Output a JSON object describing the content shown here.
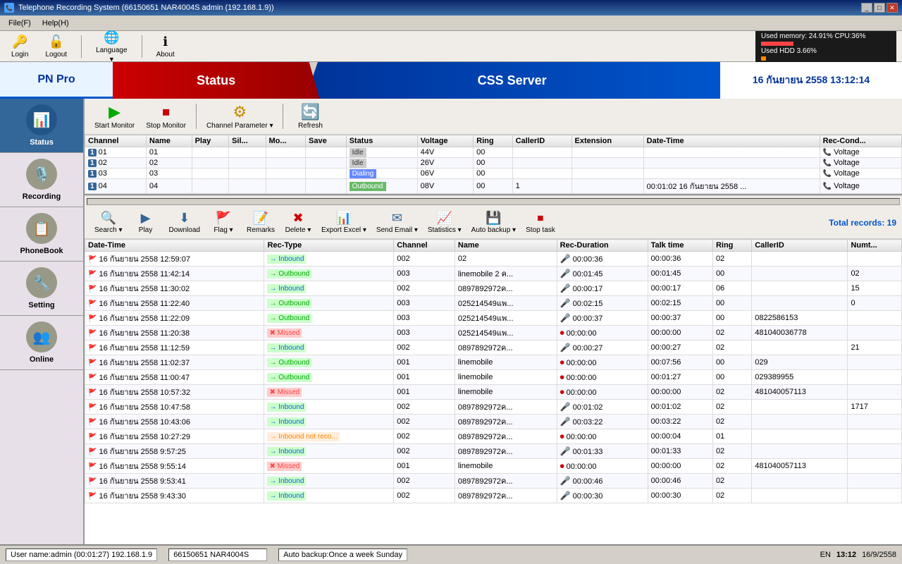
{
  "window": {
    "title": "Telephone Recording System (66150651 NAR4004S admin (192.168.1.9))"
  },
  "menubar": {
    "file_label": "File(F)",
    "help_label": "Help(H)"
  },
  "topbar": {
    "login_label": "Login",
    "logout_label": "Logout",
    "language_label": "Language",
    "about_label": "About"
  },
  "memory": {
    "cpu_label": "Used memory: 24.91% CPU:36%",
    "hdd_label": "Used HDD 3.66%",
    "cpu_pct": 25,
    "hdd_pct": 4
  },
  "banner": {
    "pn_pro": "PN Pro",
    "status": "Status",
    "css_server": "CSS Server",
    "datetime": "16 กันยายน 2558 13:12:14"
  },
  "sidebar": {
    "items": [
      {
        "label": "Status",
        "icon": "📊",
        "active": true
      },
      {
        "label": "Recording",
        "icon": "🎙️",
        "active": false
      },
      {
        "label": "PhoneBook",
        "icon": "📋",
        "active": false
      },
      {
        "label": "Setting",
        "icon": "🔧",
        "active": false
      },
      {
        "label": "Online",
        "icon": "👥",
        "active": false
      }
    ]
  },
  "monitor": {
    "buttons": [
      {
        "label": "Start Monitor",
        "icon": "▶"
      },
      {
        "label": "Stop Monitor",
        "icon": "⏹"
      },
      {
        "label": "Channel Parameter",
        "icon": "⚙",
        "dropdown": true
      },
      {
        "label": "Refresh",
        "icon": "🔄"
      }
    ],
    "columns": [
      "Channel",
      "Name",
      "Play",
      "Sil...",
      "Mo...",
      "Save",
      "Status",
      "Voltage",
      "Ring",
      "CallerID",
      "Extension",
      "Date-Time",
      "Rec-Cond..."
    ],
    "rows": [
      {
        "ch": "01",
        "name": "01",
        "play": "",
        "sil": "",
        "mo": "",
        "save": "",
        "status": "Idle",
        "voltage": "44V",
        "ring": "00",
        "callerid": "",
        "extension": "",
        "datetime": "",
        "reccond": "Voltage"
      },
      {
        "ch": "02",
        "name": "02",
        "play": "",
        "sil": "",
        "mo": "",
        "save": "",
        "status": "Idle",
        "voltage": "26V",
        "ring": "00",
        "callerid": "",
        "extension": "",
        "datetime": "",
        "reccond": "Voltage"
      },
      {
        "ch": "03",
        "name": "03",
        "play": "",
        "sil": "",
        "mo": "",
        "save": "",
        "status": "Dialing",
        "voltage": "06V",
        "ring": "00",
        "callerid": "",
        "extension": "",
        "datetime": "",
        "reccond": "Voltage"
      },
      {
        "ch": "04",
        "name": "04",
        "play": "",
        "sil": "",
        "mo": "",
        "save": "",
        "status": "Outbound",
        "voltage": "08V",
        "ring": "00",
        "callerid": "1",
        "extension": "",
        "datetime": "00:01:02 16 กันยายน 2558 ...",
        "reccond": "Voltage"
      }
    ]
  },
  "recording": {
    "total_records": "Total records: 19",
    "buttons": [
      {
        "label": "Search",
        "icon": "🔍",
        "dropdown": true
      },
      {
        "label": "Play",
        "icon": "▶"
      },
      {
        "label": "Download",
        "icon": "⬇",
        "dropdown": false
      },
      {
        "label": "Flag",
        "icon": "🚩",
        "dropdown": true
      },
      {
        "label": "Remarks",
        "icon": "📝"
      },
      {
        "label": "Delete",
        "icon": "✖",
        "dropdown": true
      },
      {
        "label": "Export Excel",
        "icon": "📊",
        "dropdown": true
      },
      {
        "label": "Send Email",
        "icon": "✉",
        "dropdown": true
      },
      {
        "label": "Statistics",
        "icon": "📈",
        "dropdown": true
      },
      {
        "label": "Auto backup",
        "icon": "💾",
        "dropdown": true
      },
      {
        "label": "Stop task",
        "icon": "⏹"
      }
    ],
    "columns": [
      "Date-Time",
      "Rec-Type",
      "Channel",
      "Name",
      "Rec-Duration",
      "Talk time",
      "Ring",
      "CallerID",
      "Numt..."
    ],
    "rows": [
      {
        "datetime": "16 กันยายน 2558 12:59:07",
        "type": "Inbound",
        "channel": "002",
        "name": "02",
        "duration": "00:00:36",
        "talk": "00:00:36",
        "ring": "02",
        "callerid": "",
        "num": ""
      },
      {
        "datetime": "16 กันยายน 2558 11:42:14",
        "type": "Outbound",
        "channel": "003",
        "name": "linemobile 2 ค...",
        "duration": "00:01:45",
        "talk": "00:01:45",
        "ring": "00",
        "callerid": "",
        "num": "02"
      },
      {
        "datetime": "16 กันยายน 2558 11:30:02",
        "type": "Inbound",
        "channel": "002",
        "name": "0897892972ค...",
        "duration": "00:00:17",
        "talk": "00:00:17",
        "ring": "06",
        "callerid": "",
        "num": "15"
      },
      {
        "datetime": "16 กันยายน 2558 11:22:40",
        "type": "Outbound",
        "channel": "003",
        "name": "025214549แพ...",
        "duration": "00:02:15",
        "talk": "00:02:15",
        "ring": "00",
        "callerid": "",
        "num": "0"
      },
      {
        "datetime": "16 กันยายน 2558 11:22:09",
        "type": "Outbound",
        "channel": "003",
        "name": "025214549แพ...",
        "duration": "00:00:37",
        "talk": "00:00:37",
        "ring": "00",
        "callerid": "0822586153",
        "num": ""
      },
      {
        "datetime": "16 กันยายน 2558 11:20:38",
        "type": "Missed",
        "channel": "003",
        "name": "025214549แพ...",
        "duration": "00:00:00",
        "talk": "00:00:00",
        "ring": "02",
        "callerid": "481040036778",
        "num": ""
      },
      {
        "datetime": "16 กันยายน 2558 11:12:59",
        "type": "Inbound",
        "channel": "002",
        "name": "0897892972ค...",
        "duration": "00:00:27",
        "talk": "00:00:27",
        "ring": "02",
        "callerid": "",
        "num": "21"
      },
      {
        "datetime": "16 กันยายน 2558 11:02:37",
        "type": "Outbound",
        "channel": "001",
        "name": "linemobile",
        "duration": "00:00:00",
        "talk": "00:07:56",
        "ring": "00",
        "callerid": "029",
        "num": ""
      },
      {
        "datetime": "16 กันยายน 2558 11:00:47",
        "type": "Outbound",
        "channel": "001",
        "name": "linemobile",
        "duration": "00:00:00",
        "talk": "00:01:27",
        "ring": "00",
        "callerid": "029389955",
        "num": ""
      },
      {
        "datetime": "16 กันยายน 2558 10:57:32",
        "type": "Missed",
        "channel": "001",
        "name": "linemobile",
        "duration": "00:00:00",
        "talk": "00:00:00",
        "ring": "02",
        "callerid": "481040057113",
        "num": ""
      },
      {
        "datetime": "16 กันยายน 2558 10:47:58",
        "type": "Inbound",
        "channel": "002",
        "name": "0897892972ค...",
        "duration": "00:01:02",
        "talk": "00:01:02",
        "ring": "02",
        "callerid": "",
        "num": "1717"
      },
      {
        "datetime": "16 กันยายน 2558 10:43:06",
        "type": "Inbound",
        "channel": "002",
        "name": "0897892972ค...",
        "duration": "00:03:22",
        "talk": "00:03:22",
        "ring": "02",
        "callerid": "",
        "num": ""
      },
      {
        "datetime": "16 กันยายน 2558 10:27:29",
        "type": "Inbound not reco...",
        "channel": "002",
        "name": "0897892972ค...",
        "duration": "00:00:00",
        "talk": "00:00:04",
        "ring": "01",
        "callerid": "",
        "num": ""
      },
      {
        "datetime": "16 กันยายน 2558 9:57:25",
        "type": "Inbound",
        "channel": "002",
        "name": "0897892972ค...",
        "duration": "00:01:33",
        "talk": "00:01:33",
        "ring": "02",
        "callerid": "",
        "num": ""
      },
      {
        "datetime": "16 กันยายน 2558 9:55:14",
        "type": "Missed",
        "channel": "001",
        "name": "linemobile",
        "duration": "00:00:00",
        "talk": "00:00:00",
        "ring": "02",
        "callerid": "481040057113",
        "num": ""
      },
      {
        "datetime": "16 กันยายน 2558 9:53:41",
        "type": "Inbound",
        "channel": "002",
        "name": "0897892972ค...",
        "duration": "00:00:46",
        "talk": "00:00:46",
        "ring": "02",
        "callerid": "",
        "num": ""
      },
      {
        "datetime": "16 กันยายน 2558 9:43:30",
        "type": "Inbound",
        "channel": "002",
        "name": "0897892972ค...",
        "duration": "00:00:30",
        "talk": "00:00:30",
        "ring": "02",
        "callerid": "",
        "num": ""
      }
    ]
  },
  "statusbar": {
    "user_info": "User name:admin (00:01:27) 192.168.1.9",
    "device_info": "66150651 NAR4004S",
    "backup_info": "Auto backup:Once a week Sunday",
    "locale": "EN",
    "time": "13:12",
    "date": "16/9/2558"
  }
}
